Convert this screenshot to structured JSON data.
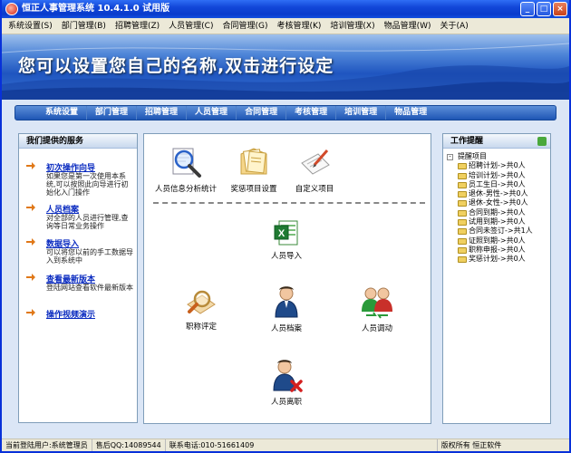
{
  "window": {
    "title": "恒正人事管理系统 10.4.1.0 试用版"
  },
  "menu": [
    "系统设置(S)",
    "部门管理(B)",
    "招聘管理(Z)",
    "人员管理(C)",
    "合同管理(G)",
    "考核管理(K)",
    "培训管理(X)",
    "物品管理(W)",
    "关于(A)"
  ],
  "banner": {
    "text": "您可以设置您自己的名称,双击进行设定"
  },
  "nav": [
    "系统设置",
    "部门管理",
    "招聘管理",
    "人员管理",
    "合同管理",
    "考核管理",
    "培训管理",
    "物品管理"
  ],
  "services": {
    "title": "我们提供的服务",
    "items": [
      {
        "link": "初次操作向导",
        "desc": "如果您是第一次使用本系统,可以按照此向导进行初始化入门操作"
      },
      {
        "link": "人员档案",
        "desc": "对全部的人员进行管理,查询等日常业务操作"
      },
      {
        "link": "数据导入",
        "desc": "可以将您以前的手工数据导入到系统中"
      },
      {
        "link": "查看最新版本",
        "desc": "登陆网站查看软件最新版本"
      },
      {
        "link": "操作视频演示",
        "desc": ""
      }
    ]
  },
  "tiles": {
    "stats": "人员信息分析统计",
    "reward": "奖惩项目设置",
    "custom": "自定义项目",
    "import": "人员导入",
    "title_eval": "职称评定",
    "archive": "人员档案",
    "transfer": "人员调动",
    "leave": "人员离职"
  },
  "reminder": {
    "title": "工作提醒",
    "root": "提醒项目",
    "items": [
      "招聘计划->共0人",
      "培训计划->共0人",
      "员工生日->共0人",
      "退休-男性->共0人",
      "退休-女性->共0人",
      "合同到期->共0人",
      "试用到期->共0人",
      "合同未签订->共1人",
      "证照到期->共0人",
      "职称申报->共0人",
      "奖惩计划->共0人"
    ]
  },
  "status": {
    "user": "当前登陆用户:系统管理员",
    "qq": "售后QQ:14089544",
    "phone": "联系电话:010-51661409",
    "rights": "版权所有 恒正软件"
  }
}
